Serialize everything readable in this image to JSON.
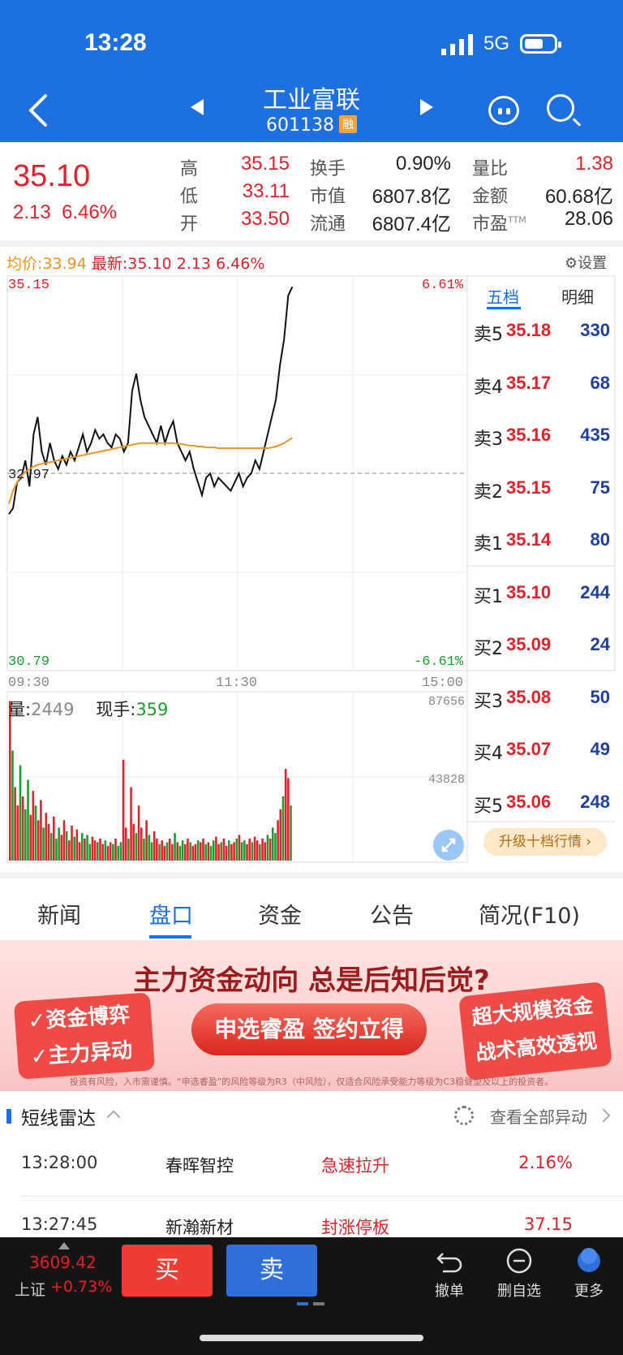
{
  "status": {
    "time": "13:28",
    "network": "5G"
  },
  "header": {
    "title": "工业富联",
    "code": "601138",
    "badge": "融"
  },
  "quote": {
    "price": "35.10",
    "change": "2.13",
    "change_pct": "6.46%",
    "stats": [
      {
        "label": "高",
        "value": "35.15",
        "color": "red"
      },
      {
        "label": "换手",
        "value": "0.90%",
        "color": "dark"
      },
      {
        "label": "量比",
        "value": "1.38",
        "color": "red"
      },
      {
        "label": "低",
        "value": "33.11",
        "color": "red"
      },
      {
        "label": "市值",
        "value": "6807.8亿",
        "color": "dark"
      },
      {
        "label": "金额",
        "value": "60.68亿",
        "color": "dark"
      },
      {
        "label": "开",
        "value": "33.50",
        "color": "red"
      },
      {
        "label": "流通",
        "value": "6807.4亿",
        "color": "dark"
      },
      {
        "label": "市盈",
        "value": "28.06",
        "color": "dark",
        "sup": "TTM"
      }
    ]
  },
  "chart_header": {
    "avg_label": "均价:33.94",
    "latest_label": "最新:35.10",
    "latest_chg": "2.13",
    "latest_pct": "6.46%",
    "settings": "设置"
  },
  "chart_data": {
    "type": "line",
    "ylim": [
      30.79,
      35.15
    ],
    "y_high_label": "35.15",
    "y_mid_label": "32.97",
    "y_low_label": "30.79",
    "pct_high_label": "6.61%",
    "pct_low_label": "-6.61%",
    "x_tick_labels": [
      "09:30",
      "11:30",
      "15:00"
    ],
    "series": [
      {
        "color": "#111111",
        "values": [
          32.48,
          32.55,
          32.85,
          32.9,
          33.1,
          32.8,
          33.4,
          33.6,
          33.2,
          33.05,
          33.3,
          33.1,
          33.0,
          33.15,
          33.05,
          33.2,
          33.1,
          33.25,
          33.4,
          33.2,
          33.3,
          33.45,
          33.35,
          33.4,
          33.3,
          33.25,
          33.4,
          33.35,
          33.2,
          33.3,
          33.9,
          34.1,
          33.8,
          33.6,
          33.5,
          33.4,
          33.3,
          33.5,
          33.3,
          33.45,
          33.55,
          33.3,
          33.2,
          33.1,
          33.2,
          33.0,
          32.85,
          32.7,
          32.9,
          32.95,
          32.8,
          32.9,
          32.85,
          32.8,
          32.75,
          32.85,
          32.95,
          32.8,
          32.9,
          32.95,
          33.1,
          33.0,
          33.2,
          33.4,
          33.6,
          33.8,
          34.2,
          34.5,
          35.0,
          35.1
        ]
      },
      {
        "color": "#f0951f",
        "values": [
          32.6,
          32.75,
          32.85,
          32.92,
          32.97,
          33.0,
          33.03,
          33.05,
          33.06,
          33.07,
          33.08,
          33.09,
          33.1,
          33.11,
          33.12,
          33.13,
          33.14,
          33.15,
          33.16,
          33.17,
          33.18,
          33.19,
          33.2,
          33.21,
          33.22,
          33.23,
          33.24,
          33.25,
          33.26,
          33.27,
          33.28,
          33.29,
          33.3,
          33.3,
          33.3,
          33.3,
          33.3,
          33.3,
          33.3,
          33.3,
          33.3,
          33.29,
          33.29,
          33.28,
          33.27,
          33.27,
          33.26,
          33.26,
          33.25,
          33.25,
          33.25,
          33.24,
          33.24,
          33.24,
          33.24,
          33.24,
          33.24,
          33.24,
          33.24,
          33.24,
          33.24,
          33.24,
          33.24,
          33.24,
          33.25,
          33.26,
          33.28,
          33.3,
          33.33,
          33.36
        ]
      }
    ],
    "volume": {
      "label": "量",
      "value": "2449",
      "hand_label": "现手",
      "hand_value": "359",
      "max_label": "87656",
      "mid_label": "43828",
      "max": 87656,
      "bars": [
        87000,
        60000,
        40000,
        30000,
        52000,
        35000,
        28000,
        44000,
        25000,
        38000,
        30000,
        22000,
        33000,
        18000,
        26000,
        20000,
        15000,
        24000,
        12000,
        18000,
        14000,
        22000,
        16000,
        11000,
        19000,
        13000,
        17000,
        10000,
        15000,
        12000,
        14000,
        9000,
        13000,
        11000,
        10000,
        12000,
        9000,
        11000,
        8000,
        10000,
        9000,
        12000,
        8000,
        10000,
        55000,
        18000,
        12000,
        40000,
        20000,
        15000,
        30000,
        18000,
        12000,
        22000,
        14000,
        10000,
        16000,
        12000,
        9000,
        11000,
        8000,
        10000,
        12000,
        9000,
        15000,
        10000,
        8000,
        11000,
        9000,
        12000,
        10000,
        8000,
        9000,
        11000,
        10000,
        12000,
        9000,
        10000,
        8000,
        11000,
        13000,
        9000,
        10000,
        12000,
        8000,
        11000,
        9000,
        10000,
        12000,
        14000,
        10000,
        11000,
        9000,
        12000,
        10000,
        13000,
        11000,
        9000,
        12000,
        10000,
        14000,
        12000,
        18000,
        15000,
        22000,
        28000,
        35000,
        50000,
        45000,
        30000
      ],
      "colors_pattern": [
        "r",
        "g",
        "r",
        "r",
        "g",
        "r",
        "g",
        "g",
        "r",
        "r",
        "g",
        "r"
      ]
    }
  },
  "orderbook": {
    "tabs": [
      "五档",
      "明细"
    ],
    "asks": [
      {
        "label": "卖5",
        "price": "35.18",
        "volume": "330"
      },
      {
        "label": "卖4",
        "price": "35.17",
        "volume": "68"
      },
      {
        "label": "卖3",
        "price": "35.16",
        "volume": "435"
      },
      {
        "label": "卖2",
        "price": "35.15",
        "volume": "75"
      },
      {
        "label": "卖1",
        "price": "35.14",
        "volume": "80"
      }
    ],
    "bids": [
      {
        "label": "买1",
        "price": "35.10",
        "volume": "244"
      },
      {
        "label": "买2",
        "price": "35.09",
        "volume": "24"
      },
      {
        "label": "买3",
        "price": "35.08",
        "volume": "50"
      },
      {
        "label": "买4",
        "price": "35.07",
        "volume": "49"
      },
      {
        "label": "买5",
        "price": "35.06",
        "volume": "248"
      }
    ],
    "upgrade": "升级十档行情 ›"
  },
  "tabs": [
    "新闻",
    "盘口",
    "资金",
    "公告",
    "简况(F10)"
  ],
  "banner": {
    "headline": "主力资金动向 总是后知后觉?",
    "left_line1": "✓资金博弈",
    "left_line2": "✓主力异动",
    "button": "申选睿盈 签约立得",
    "right_line1": "超大规模资金",
    "right_line2": "战术高效透视",
    "disclaimer": "投资有风险，入市需谨慎。“申选睿盈”的风险等级为R3（中风险），仅适合风险承受能力等级为C3稳健型及以上的投资者。"
  },
  "radar": {
    "title": "短线雷达",
    "view_all": "查看全部异动",
    "rows": [
      {
        "time": "13:28:00",
        "name": "春晖智控",
        "event": "急速拉升",
        "value": "2.16%"
      },
      {
        "time": "13:27:45",
        "name": "新瀚新材",
        "event": "封涨停板",
        "value": "37.15"
      }
    ]
  },
  "bottom": {
    "index_value": "3609.42",
    "index_name": "上证",
    "index_pct": "+0.73%",
    "buy": "买",
    "sell": "卖",
    "actions": [
      "撤单",
      "删自选",
      "更多"
    ]
  }
}
